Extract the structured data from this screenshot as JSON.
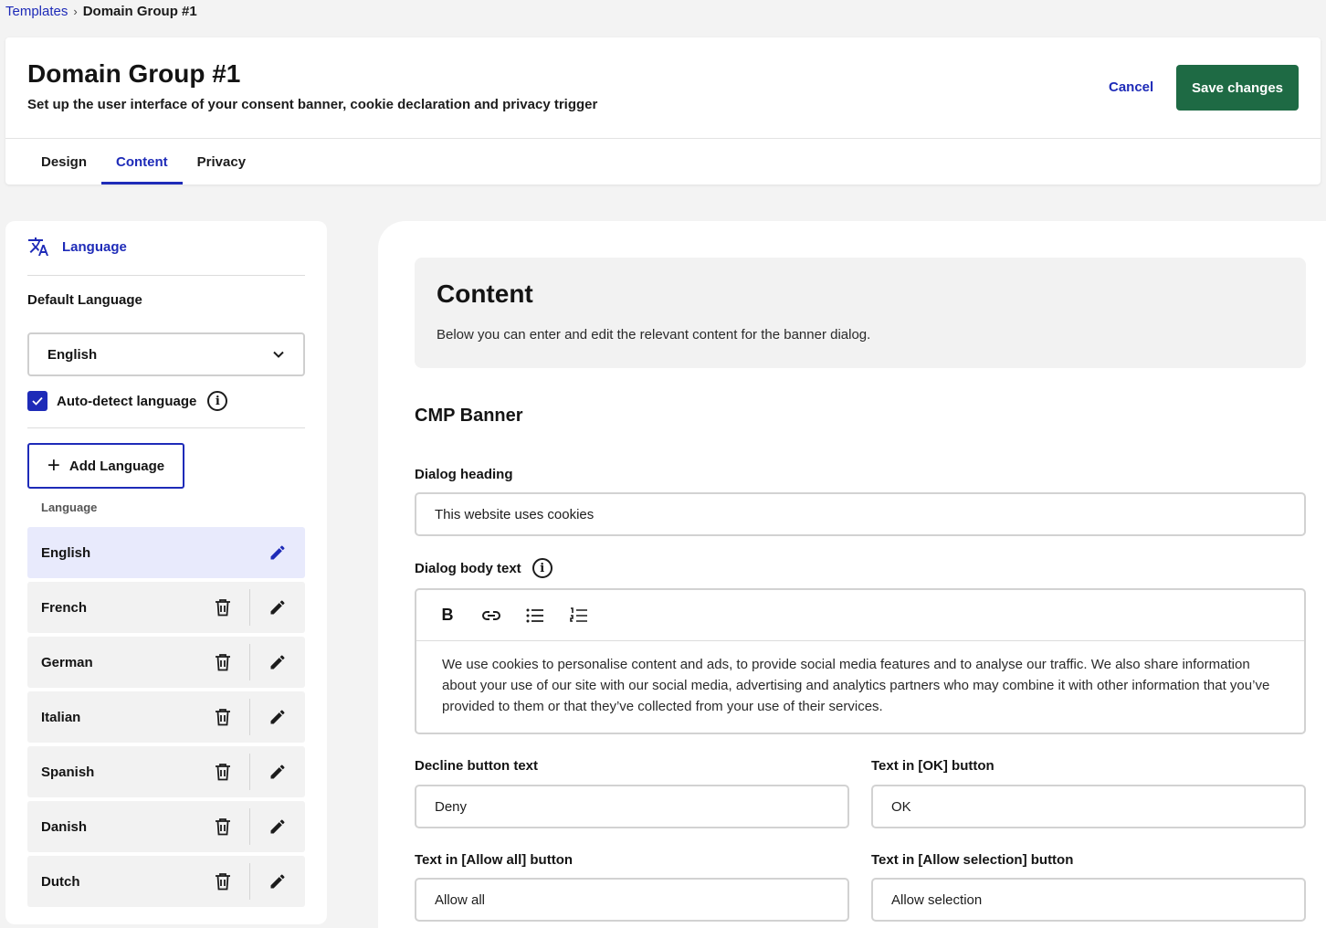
{
  "breadcrumb": {
    "parent": "Templates",
    "separator": "›",
    "current": "Domain Group #1"
  },
  "header": {
    "title": "Domain Group #1",
    "subtitle": "Set up the user interface of your consent banner, cookie declaration and privacy trigger",
    "cancel_label": "Cancel",
    "save_label": "Save changes"
  },
  "tabs": [
    {
      "label": "Design",
      "active": false
    },
    {
      "label": "Content",
      "active": true
    },
    {
      "label": "Privacy",
      "active": false
    }
  ],
  "sidebar": {
    "heading": "Language",
    "default_language_label": "Default Language",
    "default_language_value": "English",
    "auto_detect_label": "Auto-detect language",
    "auto_detect_checked": true,
    "add_language_label": "Add Language",
    "list_header": "Language",
    "languages": [
      {
        "name": "English",
        "selected": true
      },
      {
        "name": "French",
        "selected": false
      },
      {
        "name": "German",
        "selected": false
      },
      {
        "name": "Italian",
        "selected": false
      },
      {
        "name": "Spanish",
        "selected": false
      },
      {
        "name": "Danish",
        "selected": false
      },
      {
        "name": "Dutch",
        "selected": false
      }
    ]
  },
  "content": {
    "title": "Content",
    "description": "Below you can enter and edit the relevant content for the banner dialog.",
    "section_title": "CMP Banner",
    "dialog_heading_label": "Dialog heading",
    "dialog_heading_value": "This website uses cookies",
    "dialog_body_label": "Dialog body text",
    "dialog_body_value": "We use cookies to personalise content and ads, to provide social media features and to analyse our traffic. We also share information about your use of our site with our social media, advertising and analytics partners who may combine it with other information that you’ve provided to them or that they’ve collected from your use of their services.",
    "decline_label": "Decline button text",
    "decline_value": "Deny",
    "ok_label": "Text in [OK] button",
    "ok_value": "OK",
    "allow_all_label": "Text in [Allow all] button",
    "allow_all_value": "Allow all",
    "allow_selection_label": "Text in [Allow selection] button",
    "allow_selection_value": "Allow selection"
  },
  "colors": {
    "accent": "#1e2bb8",
    "save": "#1e6a44",
    "selected_row": "#e8eafc"
  }
}
